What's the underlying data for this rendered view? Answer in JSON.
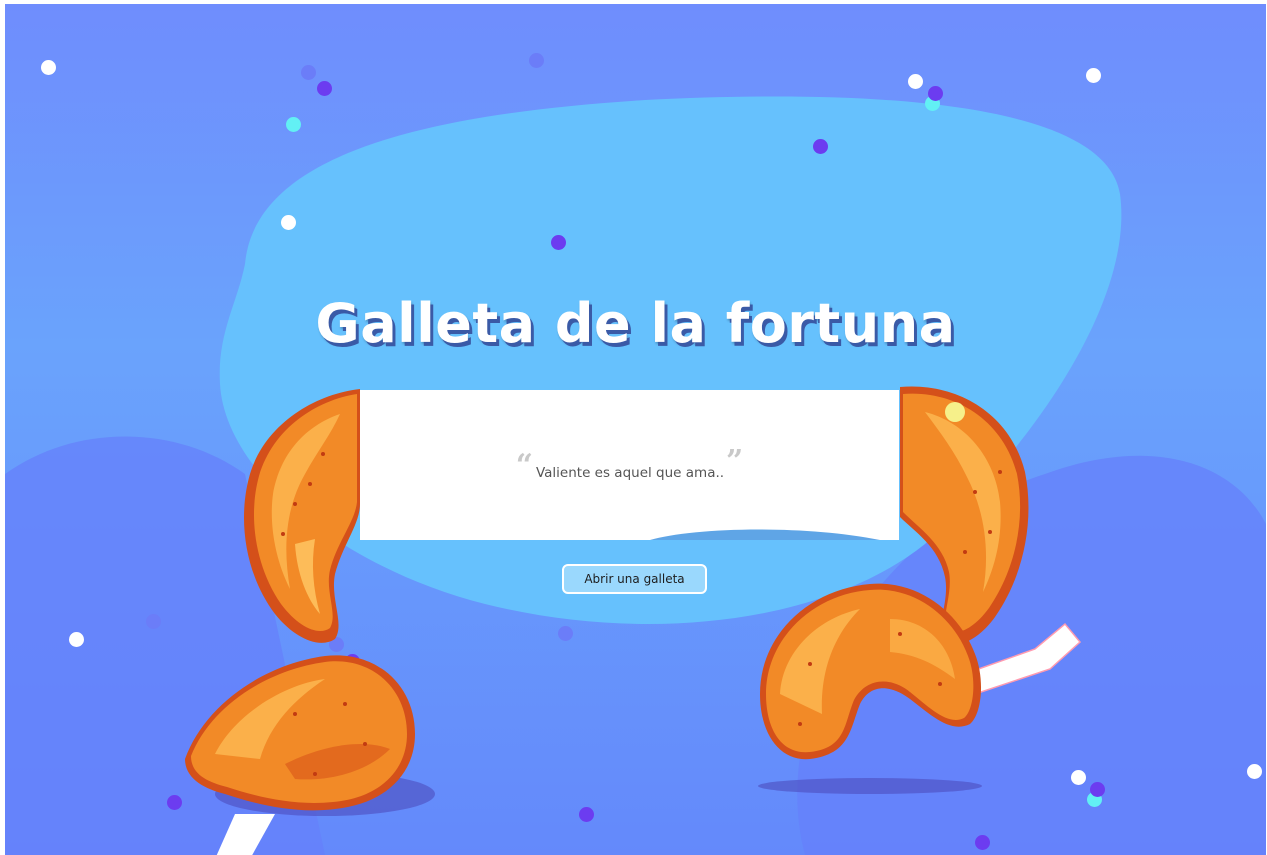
{
  "header": {
    "title": "Galleta de la fortuna"
  },
  "fortune": {
    "open_quote": "“",
    "message": "Valiente es aquel que ama..",
    "close_quote": "”"
  },
  "actions": {
    "open_cookie_label": "Abrir una galleta"
  },
  "icons": {
    "fortune_cookie": "fortune-cookie-icon",
    "confetti": "confetti-dot-icon"
  },
  "colors": {
    "background": "#6f8dfd",
    "blob": "#66c1fd",
    "button_bg": "#9ad8fd",
    "cookie_orange": "#f28a27",
    "confetti_white": "#ffffff",
    "confetti_purple": "#6c3cf0",
    "confetti_cyan": "#62f0f4"
  }
}
